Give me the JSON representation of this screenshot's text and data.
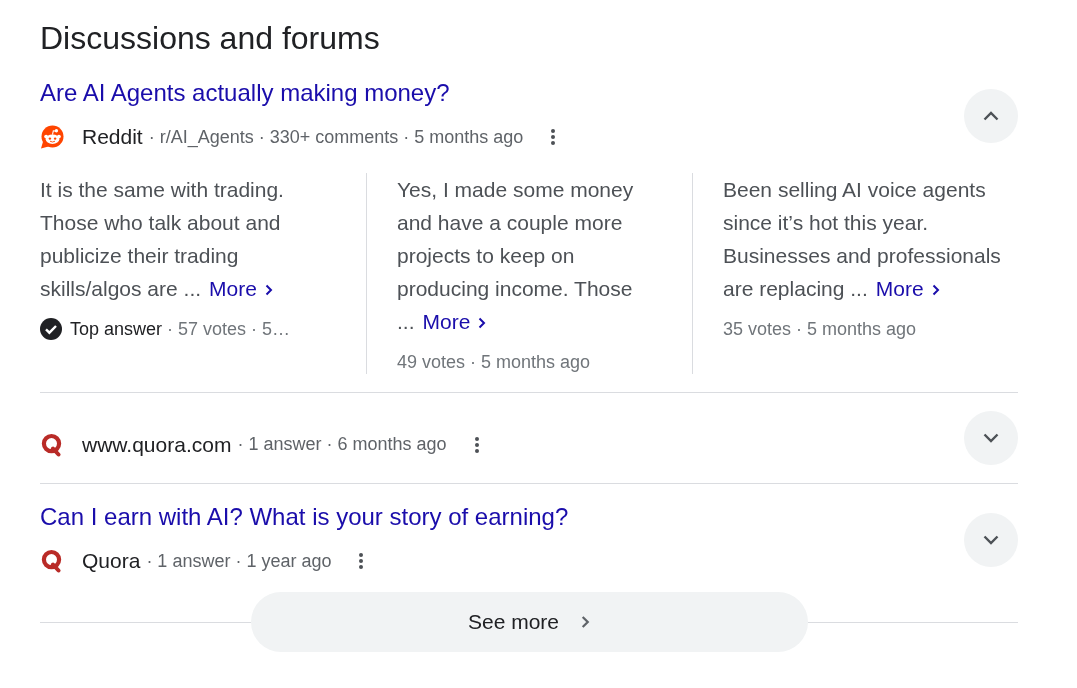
{
  "heading": "Discussions and forums",
  "results": [
    {
      "title": "Are AI Agents actually making money?",
      "source": {
        "kind": "reddit",
        "name": "Reddit",
        "meta": "· r/AI_Agents · 330+ comments · 5 months ago"
      },
      "expanded": true,
      "answers": [
        {
          "text": "It is the same with trading. Those who talk about and publicize their trading skills/algos are",
          "ellipsis": "...",
          "more": "More",
          "badge": "Top answer",
          "meta": "· 57 votes · 5…"
        },
        {
          "text": "Yes, I made some money and have a couple more projects to keep on producing income. Those",
          "ellipsis": "...",
          "more": "More",
          "meta": "49 votes · 5 months ago"
        },
        {
          "text": "Been selling AI voice agents since it’s hot this year. Businesses and professionals are replacing",
          "ellipsis": "...",
          "more": "More",
          "meta": "35 votes · 5 months ago"
        }
      ]
    },
    {
      "source": {
        "kind": "quora",
        "name": "www.quora.com",
        "meta": "· 1 answer · 6 months ago"
      },
      "expanded": false
    },
    {
      "title": "Can I earn with AI? What is your story of earning?",
      "source": {
        "kind": "quora",
        "name": "Quora",
        "meta": "· 1 answer · 1 year ago"
      },
      "expanded": false
    }
  ],
  "see_more": "See more"
}
